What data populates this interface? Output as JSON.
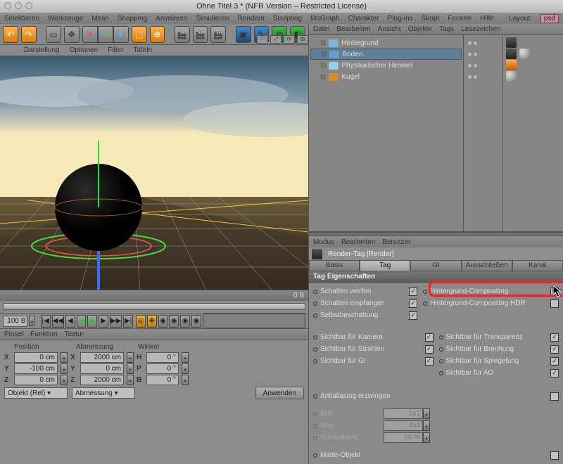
{
  "title": "Ohne Titel 3 * (NFR Version – Restricted License)",
  "menubar": [
    "Selektieren",
    "Werkzeuge",
    "Mesh",
    "Snapping",
    "Animieren",
    "Simulieren",
    "Rendern",
    "Sculpting",
    "MoGraph",
    "Charakter",
    "Plug-ins",
    "Skript",
    "Fenster",
    "Hilfe"
  ],
  "layout_label": "Layout:",
  "layout_value": "psd",
  "toolbar2": [
    "Darstellung",
    "Optionen",
    "Filter",
    "Tafeln"
  ],
  "viewport_fps_label": "0 B",
  "frame_current": "100 B",
  "tabs_bottom": [
    "Pinsel",
    "Funktion",
    "Textur"
  ],
  "coord_headers": [
    "Position",
    "Abmessung",
    "Winkel"
  ],
  "coords": {
    "X": {
      "pos": "0 cm",
      "size": "2000 cm",
      "ang": "0 °",
      "axis": "H"
    },
    "Y": {
      "pos": "-100 cm",
      "size": "0 cm",
      "ang": "0 °",
      "axis": "P"
    },
    "Z": {
      "pos": "0 cm",
      "size": "2000 cm",
      "ang": "0 °",
      "axis": "B"
    }
  },
  "coord_space": "Objekt (Rel)",
  "coord_scale": "Abmessung",
  "apply": "Anwenden",
  "om_menu": [
    "Datei",
    "Bearbeiten",
    "Ansicht",
    "Objekte",
    "Tags",
    "Lesezeichen"
  ],
  "om_items": [
    {
      "name": "Hintergrund",
      "icon": "#7fb6d6",
      "tags": [
        "film"
      ]
    },
    {
      "name": "Boden",
      "icon": "#69a0c7",
      "sel": true,
      "tags": [
        "film",
        "ball"
      ]
    },
    {
      "name": "Physikalischer Himmel",
      "icon": "#9ccde8",
      "tags": [
        "sky"
      ]
    },
    {
      "name": "Kugel",
      "icon": "#d88b2f",
      "tags": [
        "ball"
      ]
    }
  ],
  "attr_menu": [
    "Modus",
    "Bearbeiten",
    "Benutzer"
  ],
  "attr_title": "Render-Tag [Render]",
  "attr_tabs": [
    "Basis",
    "Tag",
    "GI",
    "Ausschließen",
    "Kanal"
  ],
  "attr_active_tab": 1,
  "section": "Tag Eigenschaften",
  "props_left": [
    {
      "label": "Schatten werfen",
      "checked": true
    },
    {
      "label": "Schatten empfangen",
      "checked": true
    },
    {
      "label": "Selbstbeschattung",
      "checked": true
    }
  ],
  "props_right": [
    {
      "label": "Hintergrund-Compositing",
      "checked": false,
      "hi": true
    },
    {
      "label": "Hintergrund-Compositing HDR-Maps",
      "checked": false
    }
  ],
  "props_vis_left": [
    {
      "label": "Sichtbar für Kamera",
      "checked": true
    },
    {
      "label": "Sichtbar für Strahlen",
      "checked": true
    },
    {
      "label": "Sichtbar für GI",
      "checked": true
    }
  ],
  "props_vis_right": [
    {
      "label": "Sichtbar für Transparenz",
      "checked": true
    },
    {
      "label": "Sichtbar für Brechung",
      "checked": true
    },
    {
      "label": "Sichtbar für Spiegelung",
      "checked": true
    },
    {
      "label": "Sichtbar für AO",
      "checked": true
    }
  ],
  "antialias": {
    "label": "Antialiasing erzwingen",
    "checked": false
  },
  "mini": [
    {
      "label": "Min",
      "val": "1x1"
    },
    {
      "label": "Max",
      "val": "4x4"
    },
    {
      "label": "Schwellwert",
      "val": "10 %"
    }
  ],
  "matte": {
    "label": "Matte-Objekt",
    "checked": false
  }
}
